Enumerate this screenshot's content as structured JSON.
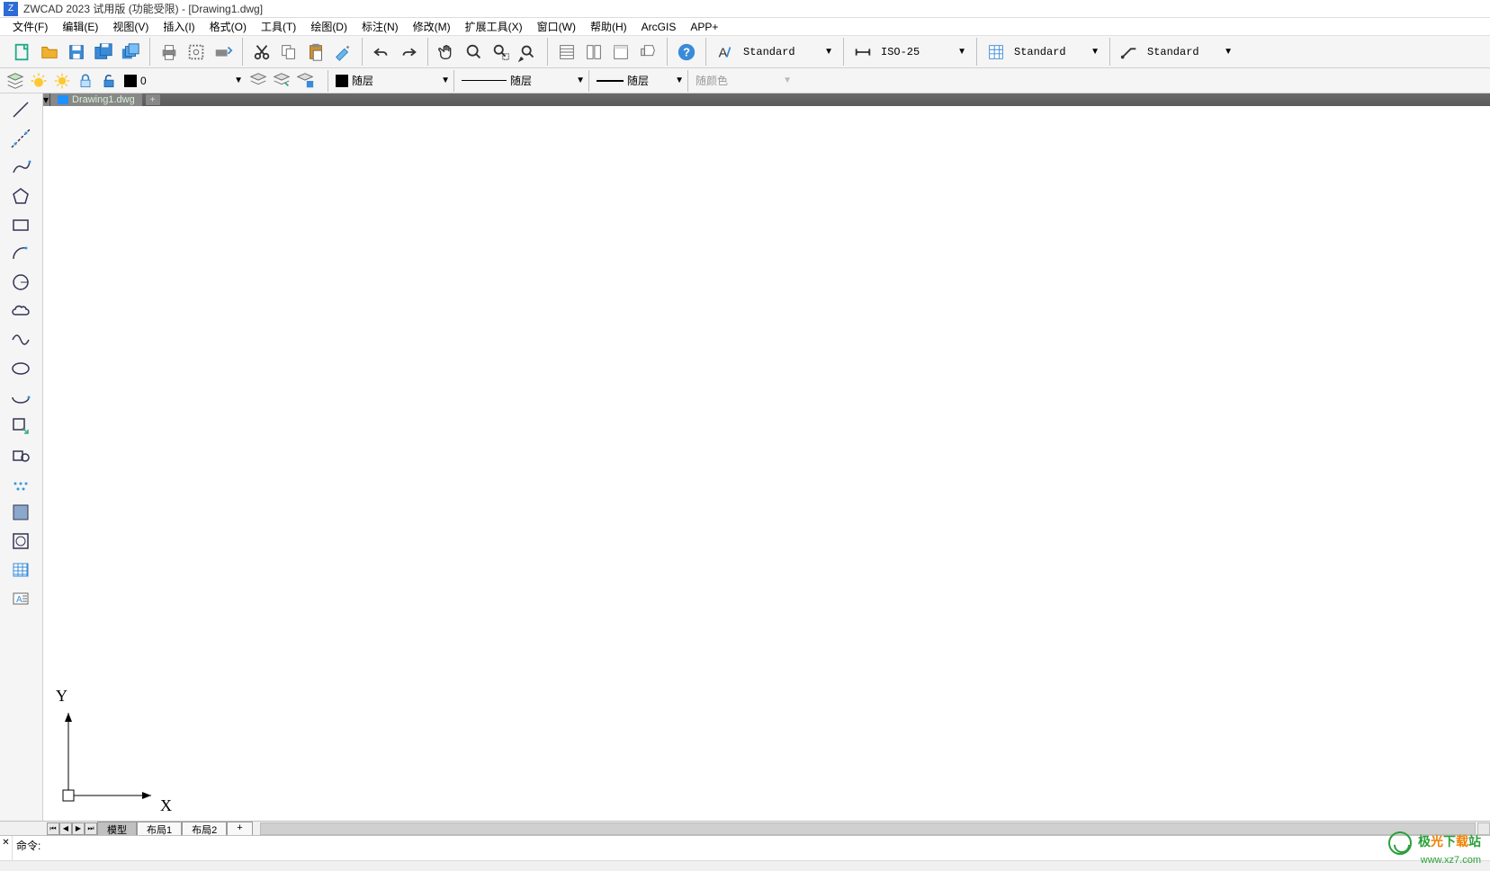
{
  "title": "ZWCAD 2023 试用版 (功能受限) - [Drawing1.dwg]",
  "menu": {
    "file": "文件(F)",
    "edit": "编辑(E)",
    "view": "视图(V)",
    "insert": "插入(I)",
    "format": "格式(O)",
    "tools": "工具(T)",
    "draw": "绘图(D)",
    "dimension": "标注(N)",
    "modify": "修改(M)",
    "extend": "扩展工具(X)",
    "window": "窗口(W)",
    "help": "帮助(H)",
    "arcgis": "ArcGIS",
    "app": "APP+"
  },
  "styles": {
    "text_style": "Standard",
    "dim_style": "ISO-25",
    "table_style": "Standard",
    "mleader_style": "Standard"
  },
  "layer": {
    "current": "0",
    "linetype": "随层",
    "lineweight": "随层",
    "plotstyle": "随层",
    "color": "随颜色"
  },
  "tab": {
    "file": "Drawing1.dwg",
    "plus": "+"
  },
  "layouts": {
    "model": "模型",
    "layout1": "布局1",
    "layout2": "布局2",
    "add": "+"
  },
  "ucs": {
    "x": "X",
    "y": "Y"
  },
  "cmd": {
    "prompt": "命令:",
    "close": "✕"
  },
  "watermark": {
    "text": "极光下载站",
    "url": "www.xz7.com",
    "colors": [
      "#2aa03a",
      "#f08000",
      "#2aa03a",
      "#f08000",
      "#2aa03a"
    ]
  }
}
